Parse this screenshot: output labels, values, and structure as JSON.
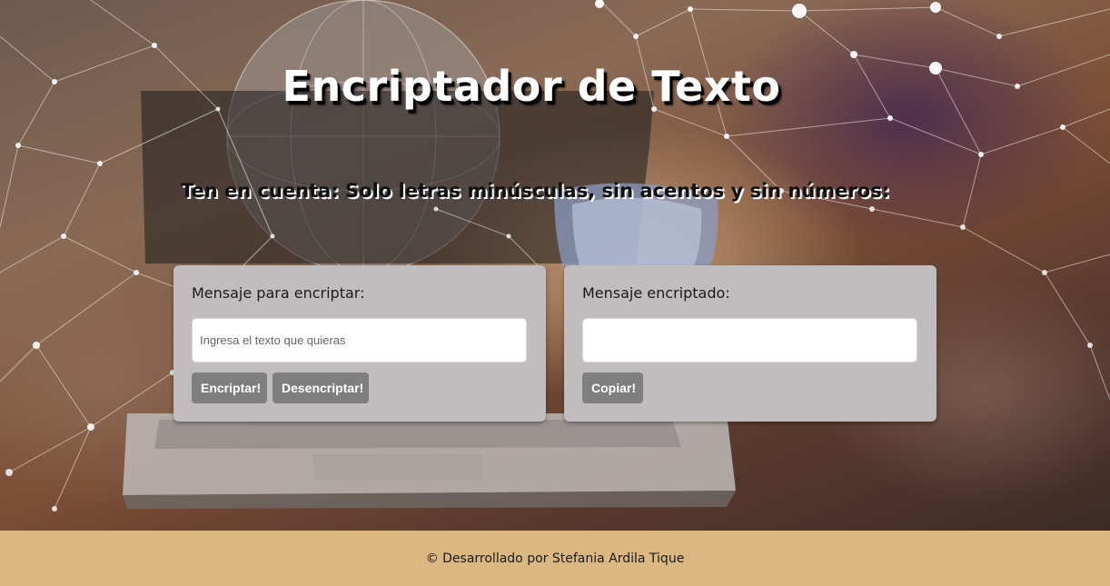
{
  "header": {
    "title": "Encriptador de Texto",
    "notice": "Ten en cuenta: Solo letras minúsculas, sin acentos y sin números:"
  },
  "encrypt_card": {
    "label": "Mensaje para encriptar:",
    "input_value": "",
    "input_placeholder": "Ingresa el texto que quieras",
    "encrypt_button": "Encriptar!",
    "decrypt_button": "Desencriptar!"
  },
  "result_card": {
    "label": "Mensaje encriptado:",
    "output_value": "",
    "copy_button": "Copiar!"
  },
  "footer": {
    "text": "© Desarrollado por Stefania Ardila Tique"
  },
  "colors": {
    "card_background": "#c1bcbd",
    "button_background": "#7f7f7f",
    "footer_background": "#dbb882"
  }
}
